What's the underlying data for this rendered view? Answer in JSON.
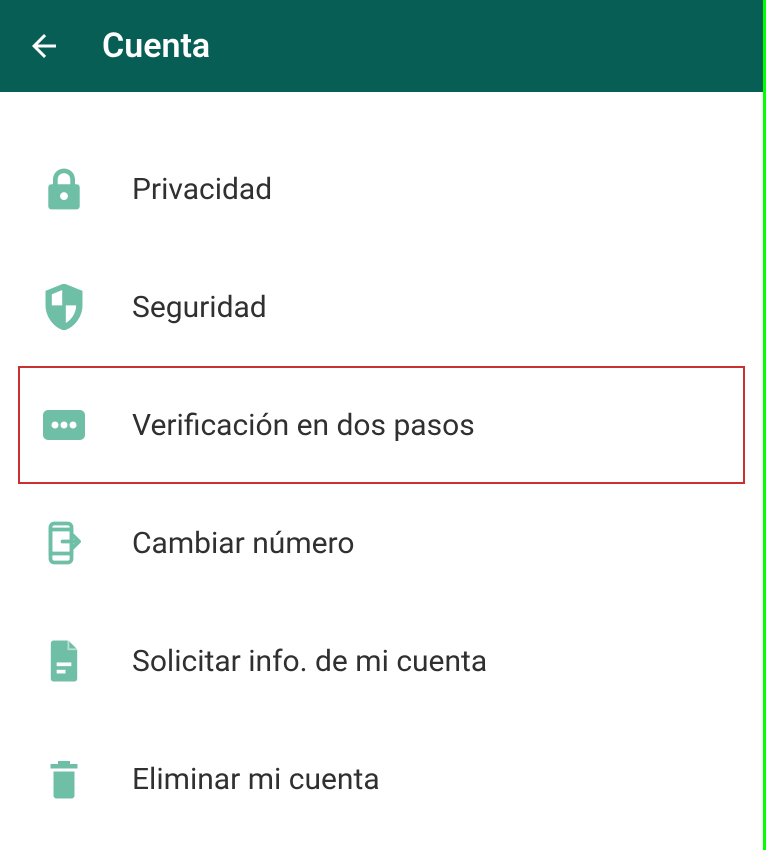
{
  "header": {
    "title": "Cuenta"
  },
  "menu": {
    "items": [
      {
        "icon": "lock-icon",
        "label": "Privacidad",
        "highlighted": false
      },
      {
        "icon": "shield-icon",
        "label": "Seguridad",
        "highlighted": false
      },
      {
        "icon": "dots-card-icon",
        "label": "Verificación en dos pasos",
        "highlighted": true
      },
      {
        "icon": "phone-transfer-icon",
        "label": "Cambiar número",
        "highlighted": false
      },
      {
        "icon": "document-icon",
        "label": "Solicitar info. de mi cuenta",
        "highlighted": false
      },
      {
        "icon": "trash-icon",
        "label": "Eliminar mi cuenta",
        "highlighted": false
      }
    ]
  },
  "colors": {
    "header_bg": "#075e54",
    "icon_tint": "#6fbfa7",
    "highlight_border": "#c93030"
  }
}
